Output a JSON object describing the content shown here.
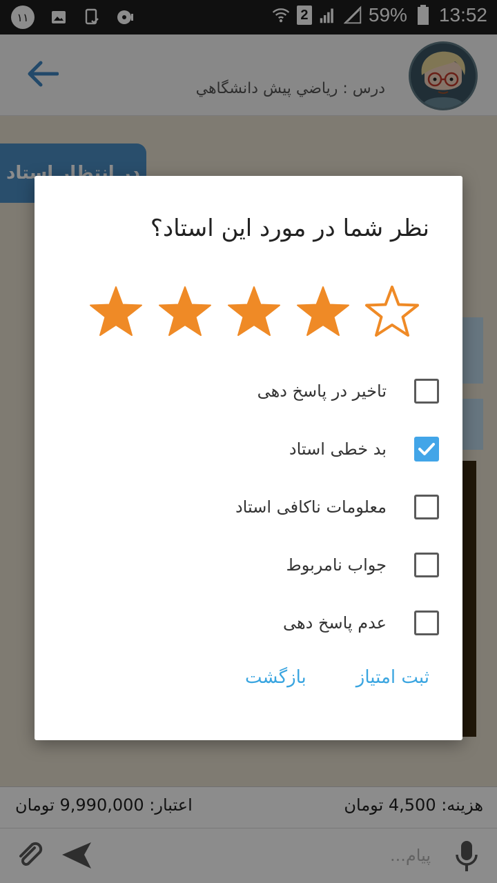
{
  "status_bar": {
    "notification_count": "۱۱",
    "sim_slot": "2",
    "battery": "59%",
    "time": "13:52"
  },
  "header": {
    "course_title": "درس : رياضي پيش دانشگاهي"
  },
  "chat": {
    "pending_label": "در انتظار استاد"
  },
  "dialog": {
    "title": "نظر شما در مورد این استاد؟",
    "rating": {
      "value": 4,
      "max": 5
    },
    "options": [
      {
        "label": "تاخیر در پاسخ دهی",
        "checked": false
      },
      {
        "label": "بد خطی استاد",
        "checked": true
      },
      {
        "label": "معلومات ناکافی استاد",
        "checked": false
      },
      {
        "label": "جواب نامربوط",
        "checked": false
      },
      {
        "label": "عدم پاسخ دهی",
        "checked": false
      }
    ],
    "submit_label": "ثبت امتیاز",
    "back_label": "بازگشت"
  },
  "info": {
    "cost": "هزینه: 4,500 تومان",
    "credit": "اعتبار: 9,990,000 تومان"
  },
  "composer": {
    "placeholder": "پیام..."
  },
  "colors": {
    "star": "#ef8a26",
    "accent": "#42a5e8",
    "header_blue": "#3f86c1"
  }
}
